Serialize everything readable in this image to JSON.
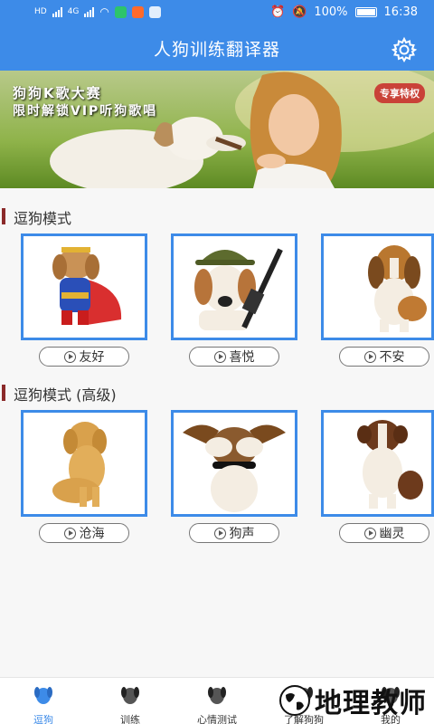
{
  "status_bar": {
    "hd1": "HD",
    "hd2": "HD",
    "net1": "4G",
    "net2": "4G",
    "battery": "100%",
    "time": "16:38"
  },
  "app_bar": {
    "title": "人狗训练翻译器"
  },
  "banner": {
    "headline": "狗狗K歌大赛",
    "subline": "限时解锁VIP听狗歌唱",
    "vip_badge": "专享特权"
  },
  "sections": [
    {
      "title": "逗狗模式",
      "items": [
        {
          "label": "友好",
          "image": "superhero-costume-dog"
        },
        {
          "label": "喜悦",
          "image": "army-helmet-dog"
        },
        {
          "label": "不安",
          "image": "beagle-puppy"
        }
      ]
    },
    {
      "title": "逗狗模式 (高级)",
      "items": [
        {
          "label": "沧海",
          "image": "golden-retriever"
        },
        {
          "label": "狗声",
          "image": "dog-covering-eyes"
        },
        {
          "label": "幽灵",
          "image": "collie-puppy"
        }
      ]
    }
  ],
  "tabs": [
    {
      "label": "逗狗",
      "active": true
    },
    {
      "label": "训练",
      "active": false
    },
    {
      "label": "心情测试",
      "active": false
    },
    {
      "label": "了解狗狗",
      "active": false
    },
    {
      "label": "我的",
      "active": false
    }
  ],
  "watermark": {
    "text": "地理教师"
  },
  "colors": {
    "primary": "#3d8be8",
    "section_bar": "#8b2a2a"
  }
}
